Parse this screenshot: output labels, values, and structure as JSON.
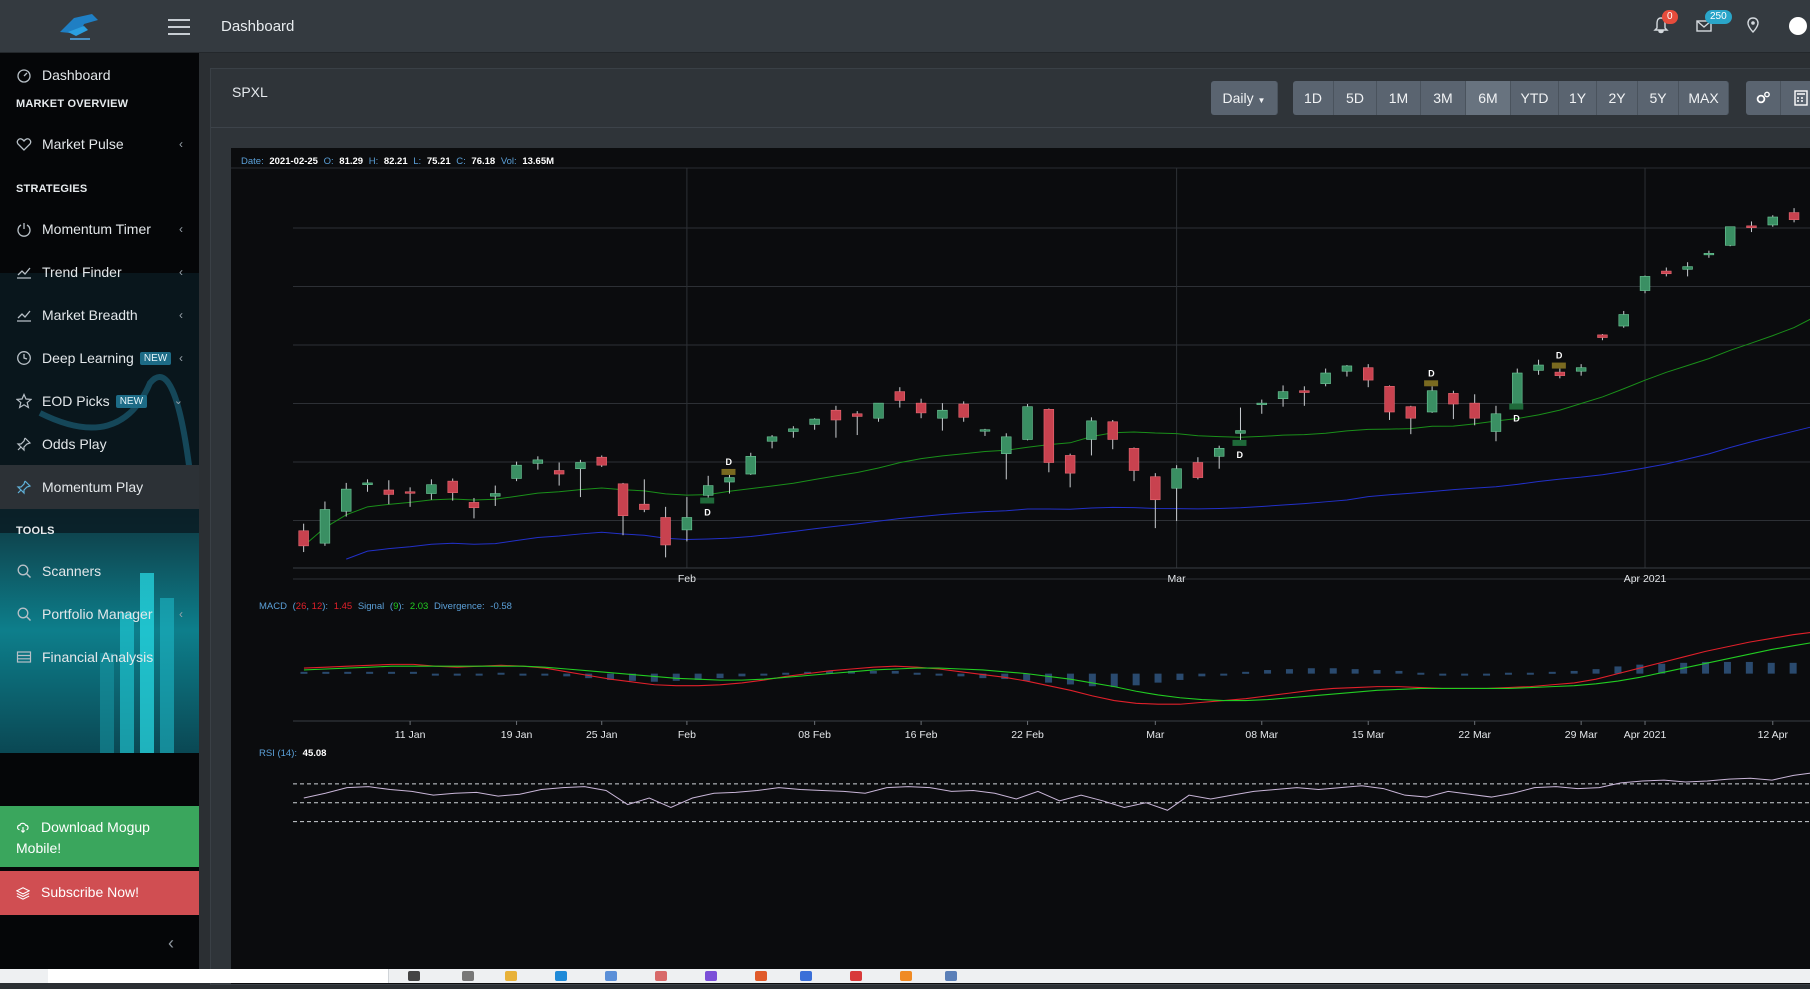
{
  "header": {
    "title": "Dashboard",
    "notifications_count": "0",
    "messages_count": "250"
  },
  "sidebar": {
    "dashboard": "Dashboard",
    "market_overview_heading": "MARKET OVERVIEW",
    "market_pulse": "Market Pulse",
    "strategies_heading": "STRATEGIES",
    "momentum_timer": "Momentum Timer",
    "trend_finder": "Trend Finder",
    "market_breadth": "Market Breadth",
    "deep_learning": "Deep Learning",
    "eod_picks": "EOD Picks",
    "new_badge": "NEW",
    "odds_play": "Odds Play",
    "momentum_play": "Momentum Play",
    "tools_heading": "TOOLS",
    "scanners": "Scanners",
    "portfolio_manager": "Portfolio Manager",
    "financial_analysis": "Financial Analysis",
    "download_line1": "Download Mogup",
    "download_line2": "Mobile!",
    "subscribe": "Subscribe Now!"
  },
  "toolbar": {
    "symbol": "SPXL",
    "interval_label": "Daily",
    "ranges": [
      "1D",
      "5D",
      "1M",
      "3M",
      "6M",
      "YTD",
      "1Y",
      "2Y",
      "5Y",
      "MAX"
    ]
  },
  "chart_info": {
    "date_label": "Date:",
    "date": "2021-02-25",
    "o_label": "O:",
    "o": "81.29",
    "h_label": "H:",
    "h": "82.21",
    "l_label": "L:",
    "l": "75.21",
    "c_label": "C:",
    "c": "76.18",
    "vol_label": "Vol:",
    "vol": "13.65M",
    "main_month_labels": [
      "Feb",
      "Mar",
      "Apr 2021"
    ],
    "macd_label": "MACD",
    "macd_params_a": "26",
    "macd_params_b": "12",
    "macd_value": "1.45",
    "signal_label": "Signal",
    "signal_param": "9",
    "signal_value": "2.03",
    "divergence_label": "Divergence:",
    "divergence_value": "-0.58",
    "date_ticks": [
      "11 Jan",
      "19 Jan",
      "25 Jan",
      "Feb",
      "08 Feb",
      "16 Feb",
      "22 Feb",
      "Mar",
      "08 Mar",
      "15 Mar",
      "22 Mar",
      "29 Mar",
      "Apr 2021",
      "12 Apr"
    ],
    "rsi_label": "RSI (14):",
    "rsi_value": "45.08",
    "marker_letter": "D"
  },
  "colors": {
    "up": "#3a8f63",
    "down": "#c8424f",
    "ma_fast": "#1a8f1a",
    "ma_slow": "#2230c8",
    "macd": "#e0202a",
    "signal": "#22cc22",
    "hist": "#2a4a6e",
    "rsi": "#c9b6d8",
    "accent": "#1d6b86"
  },
  "chart_data": {
    "type": "candlestick",
    "series": [
      {
        "name": "SPXL",
        "values": [
          {
            "o": 66.2,
            "h": 67.0,
            "l": 63.8,
            "c": 64.5
          },
          {
            "o": 64.8,
            "h": 69.5,
            "l": 64.5,
            "c": 68.6
          },
          {
            "o": 68.4,
            "h": 71.6,
            "l": 67.8,
            "c": 70.9
          },
          {
            "o": 71.4,
            "h": 72.0,
            "l": 70.6,
            "c": 71.6
          },
          {
            "o": 70.8,
            "h": 71.9,
            "l": 69.2,
            "c": 70.3
          },
          {
            "o": 70.6,
            "h": 71.1,
            "l": 68.9,
            "c": 70.5
          },
          {
            "o": 70.4,
            "h": 72.0,
            "l": 69.7,
            "c": 71.4
          },
          {
            "o": 71.8,
            "h": 72.1,
            "l": 69.6,
            "c": 70.5
          },
          {
            "o": 69.4,
            "h": 69.9,
            "l": 67.6,
            "c": 68.8
          },
          {
            "o": 70.1,
            "h": 71.3,
            "l": 69.0,
            "c": 70.4
          },
          {
            "o": 72.1,
            "h": 74.0,
            "l": 71.8,
            "c": 73.6
          },
          {
            "o": 73.8,
            "h": 74.6,
            "l": 73.1,
            "c": 74.2
          },
          {
            "o": 73.0,
            "h": 73.9,
            "l": 71.3,
            "c": 72.6
          },
          {
            "o": 73.2,
            "h": 74.2,
            "l": 70.0,
            "c": 73.9
          },
          {
            "o": 74.5,
            "h": 74.7,
            "l": 73.4,
            "c": 73.6
          },
          {
            "o": 71.5,
            "h": 71.6,
            "l": 65.7,
            "c": 67.9
          },
          {
            "o": 69.2,
            "h": 72.0,
            "l": 68.3,
            "c": 68.6
          },
          {
            "o": 67.7,
            "h": 68.9,
            "l": 63.2,
            "c": 64.6
          },
          {
            "o": 66.3,
            "h": 70.0,
            "l": 65.0,
            "c": 67.7
          },
          {
            "o": 70.2,
            "h": 72.4,
            "l": 69.5,
            "c": 71.3
          },
          {
            "o": 71.7,
            "h": 72.5,
            "l": 70.4,
            "c": 72.2
          },
          {
            "o": 72.6,
            "h": 75.0,
            "l": 72.5,
            "c": 74.6
          },
          {
            "o": 76.3,
            "h": 77.0,
            "l": 75.5,
            "c": 76.8
          },
          {
            "o": 77.4,
            "h": 78.0,
            "l": 76.7,
            "c": 77.7
          },
          {
            "o": 78.2,
            "h": 78.9,
            "l": 77.6,
            "c": 78.8
          },
          {
            "o": 79.8,
            "h": 80.3,
            "l": 76.7,
            "c": 78.7
          },
          {
            "o": 79.4,
            "h": 79.7,
            "l": 77.0,
            "c": 79.1
          },
          {
            "o": 78.9,
            "h": 80.6,
            "l": 78.5,
            "c": 80.6
          },
          {
            "o": 81.9,
            "h": 82.4,
            "l": 80.1,
            "c": 80.9
          },
          {
            "o": 80.6,
            "h": 81.1,
            "l": 78.9,
            "c": 79.5
          },
          {
            "o": 78.9,
            "h": 80.6,
            "l": 77.5,
            "c": 79.8
          },
          {
            "o": 80.5,
            "h": 80.8,
            "l": 78.5,
            "c": 79.0
          },
          {
            "o": 77.5,
            "h": 77.7,
            "l": 76.9,
            "c": 77.6
          },
          {
            "o": 74.9,
            "h": 77.2,
            "l": 72.0,
            "c": 76.8
          },
          {
            "o": 76.5,
            "h": 80.5,
            "l": 76.4,
            "c": 80.2
          },
          {
            "o": 79.9,
            "h": 80.0,
            "l": 72.8,
            "c": 73.9
          },
          {
            "o": 74.7,
            "h": 74.9,
            "l": 71.1,
            "c": 72.7
          },
          {
            "o": 76.5,
            "h": 79.0,
            "l": 74.7,
            "c": 78.6
          },
          {
            "o": 78.5,
            "h": 78.7,
            "l": 75.4,
            "c": 76.5
          },
          {
            "o": 75.5,
            "h": 75.6,
            "l": 71.8,
            "c": 73.0
          },
          {
            "o": 72.3,
            "h": 72.7,
            "l": 66.5,
            "c": 69.7
          },
          {
            "o": 71.0,
            "h": 73.6,
            "l": 67.3,
            "c": 73.2
          },
          {
            "o": 73.9,
            "h": 74.5,
            "l": 72.0,
            "c": 72.2
          },
          {
            "o": 74.6,
            "h": 75.8,
            "l": 73.2,
            "c": 75.5
          },
          {
            "o": 77.2,
            "h": 80.1,
            "l": 76.0,
            "c": 77.5
          },
          {
            "o": 80.5,
            "h": 81.0,
            "l": 79.4,
            "c": 80.6
          },
          {
            "o": 81.1,
            "h": 82.6,
            "l": 80.2,
            "c": 81.9
          },
          {
            "o": 82.0,
            "h": 82.5,
            "l": 80.3,
            "c": 81.8
          },
          {
            "o": 82.8,
            "h": 84.5,
            "l": 82.5,
            "c": 84.0
          },
          {
            "o": 84.2,
            "h": 84.9,
            "l": 83.6,
            "c": 84.8
          },
          {
            "o": 84.6,
            "h": 85.0,
            "l": 82.4,
            "c": 83.2
          },
          {
            "o": 82.5,
            "h": 82.6,
            "l": 78.7,
            "c": 79.6
          },
          {
            "o": 80.2,
            "h": 80.3,
            "l": 77.1,
            "c": 78.9
          },
          {
            "o": 79.6,
            "h": 82.5,
            "l": 79.5,
            "c": 82.0
          },
          {
            "o": 81.7,
            "h": 82.0,
            "l": 78.8,
            "c": 80.5
          },
          {
            "o": 80.6,
            "h": 81.6,
            "l": 78.1,
            "c": 78.9
          },
          {
            "o": 77.4,
            "h": 80.3,
            "l": 76.3,
            "c": 79.4
          },
          {
            "o": 80.3,
            "h": 84.5,
            "l": 80.1,
            "c": 84.0
          },
          {
            "o": 84.3,
            "h": 85.5,
            "l": 83.8,
            "c": 84.9
          },
          {
            "o": 84.1,
            "h": 84.5,
            "l": 83.4,
            "c": 83.7
          },
          {
            "o": 84.2,
            "h": 85.0,
            "l": 83.7,
            "c": 84.6
          },
          {
            "o": 88.3,
            "h": 88.4,
            "l": 87.7,
            "c": 88.0
          },
          {
            "o": 89.3,
            "h": 91.0,
            "l": 89.1,
            "c": 90.6
          },
          {
            "o": 93.3,
            "h": 95.0,
            "l": 93.0,
            "c": 94.9
          },
          {
            "o": 95.5,
            "h": 95.9,
            "l": 94.9,
            "c": 95.2
          },
          {
            "o": 95.7,
            "h": 96.5,
            "l": 94.9,
            "c": 96.0
          },
          {
            "o": 97.4,
            "h": 97.8,
            "l": 97.0,
            "c": 97.5
          },
          {
            "o": 98.4,
            "h": 100.5,
            "l": 98.3,
            "c": 100.5
          },
          {
            "o": 100.6,
            "h": 101.1,
            "l": 99.9,
            "c": 100.4
          },
          {
            "o": 100.7,
            "h": 101.8,
            "l": 100.5,
            "c": 101.6
          },
          {
            "o": 102.1,
            "h": 102.6,
            "l": 101.0,
            "c": 101.3
          },
          {
            "o": 103.4,
            "h": 104.3,
            "l": 103.1,
            "c": 104.3
          }
        ]
      }
    ],
    "ylim": [
      62,
      106
    ],
    "macd": {
      "macd": [
        0.6,
        0.7,
        0.8,
        0.9,
        1.0,
        1.0,
        0.8,
        0.7,
        0.8,
        0.9,
        0.8,
        0.6,
        0.2,
        -0.2,
        -0.6,
        -0.9,
        -1.2,
        -1.3,
        -1.3,
        -1.2,
        -1.0,
        -0.7,
        -0.3,
        0.0,
        0.3,
        0.5,
        0.7,
        0.8,
        0.7,
        0.5,
        0.2,
        -0.1,
        -0.4,
        -0.8,
        -1.3,
        -1.8,
        -2.4,
        -2.9,
        -3.2,
        -3.3,
        -3.3,
        -3.1,
        -2.9,
        -2.7,
        -2.4,
        -2.1,
        -1.8,
        -1.6,
        -1.5,
        -1.4,
        -1.4,
        -1.5,
        -1.6,
        -1.6,
        -1.6,
        -1.5,
        -1.4,
        -1.2,
        -1.0,
        -0.6,
        0.0,
        0.6,
        1.2,
        1.8,
        2.4,
        2.9,
        3.4,
        3.8,
        4.2,
        4.5
      ],
      "signal": [
        0.4,
        0.5,
        0.6,
        0.7,
        0.8,
        0.8,
        0.8,
        0.8,
        0.8,
        0.8,
        0.8,
        0.7,
        0.5,
        0.3,
        0.1,
        -0.1,
        -0.3,
        -0.5,
        -0.6,
        -0.7,
        -0.7,
        -0.6,
        -0.4,
        -0.2,
        0.0,
        0.2,
        0.4,
        0.5,
        0.6,
        0.6,
        0.5,
        0.4,
        0.2,
        0.0,
        -0.3,
        -0.6,
        -1.0,
        -1.4,
        -1.9,
        -2.3,
        -2.6,
        -2.8,
        -2.9,
        -2.9,
        -2.8,
        -2.6,
        -2.4,
        -2.2,
        -2.0,
        -1.8,
        -1.7,
        -1.6,
        -1.6,
        -1.6,
        -1.6,
        -1.6,
        -1.5,
        -1.4,
        -1.3,
        -1.1,
        -0.8,
        -0.4,
        0.1,
        0.6,
        1.1,
        1.6,
        2.1,
        2.6,
        3.0,
        3.4
      ],
      "ylim": [
        -5,
        6
      ]
    },
    "rsi": {
      "period": 14,
      "values": [
        55,
        60,
        66,
        67,
        64,
        62,
        58,
        60,
        61,
        57,
        59,
        64,
        66,
        67,
        63,
        48,
        55,
        45,
        55,
        60,
        61,
        63,
        66,
        64,
        63,
        62,
        60,
        66,
        67,
        66,
        62,
        63,
        60,
        54,
        62,
        52,
        58,
        52,
        45,
        50,
        42,
        58,
        54,
        58,
        62,
        64,
        66,
        64,
        66,
        68,
        65,
        58,
        56,
        62,
        59,
        56,
        60,
        66,
        67,
        65,
        66,
        71,
        73,
        74,
        72,
        73,
        75,
        76,
        74,
        79,
        82
      ],
      "levels": [
        70,
        50,
        30
      ],
      "ylim": [
        20,
        90
      ]
    }
  }
}
